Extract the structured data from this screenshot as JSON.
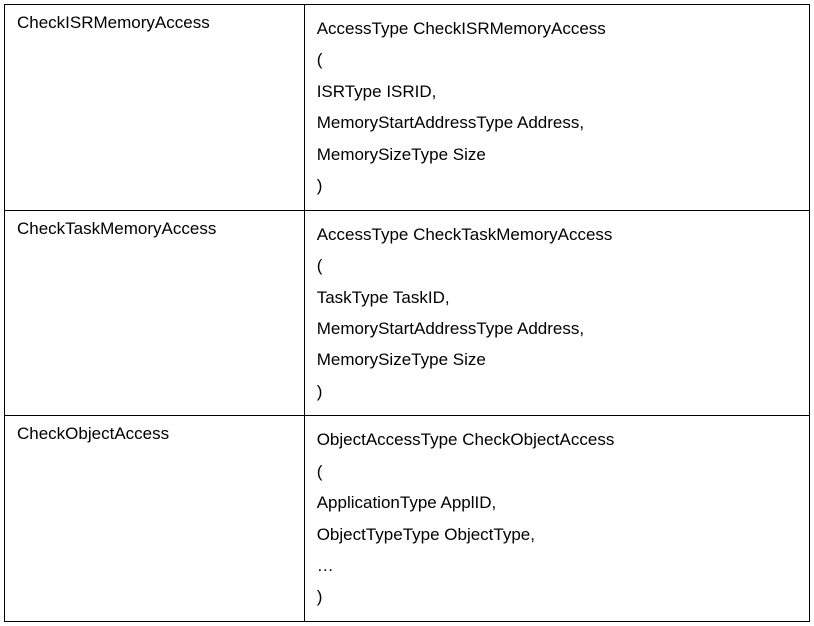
{
  "rows": [
    {
      "name": "CheckISRMemoryAccess",
      "lines": [
        "AccessType CheckISRMemoryAccess",
        "(",
        "ISRType ISRID,",
        "MemoryStartAddressType Address,",
        "MemorySizeType Size",
        ")"
      ]
    },
    {
      "name": "CheckTaskMemoryAccess",
      "lines": [
        "AccessType CheckTaskMemoryAccess",
        "(",
        "TaskType TaskID,",
        "MemoryStartAddressType Address,",
        "MemorySizeType Size",
        ")"
      ]
    },
    {
      "name": "CheckObjectAccess",
      "lines": [
        "ObjectAccessType CheckObjectAccess",
        "(",
        "ApplicationType ApplID,",
        "ObjectTypeType ObjectType,",
        "…",
        ")"
      ]
    }
  ]
}
